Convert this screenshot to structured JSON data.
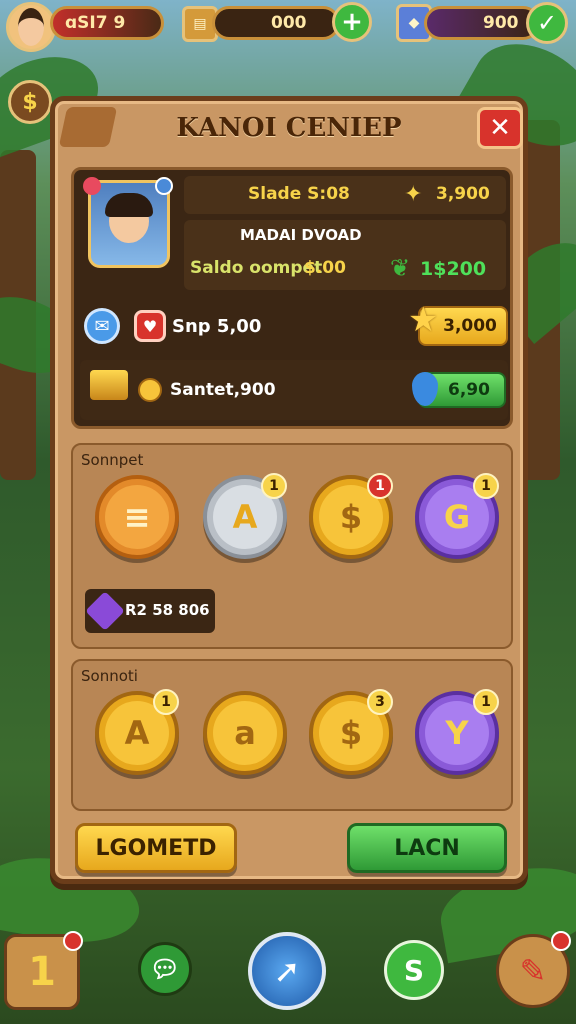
{
  "top_bar": {
    "lives_value": "ɑSI7 9",
    "energy_value": "000",
    "gems_value": "900",
    "plus_icon": "plus-icon",
    "check_icon": "check-icon"
  },
  "dialog": {
    "title": "KANOI CENIEP",
    "close_icon": "close-icon",
    "profile": {
      "slade_label": "Slade S:08",
      "slade_value": "3,900",
      "name_line": "MADAI DVOAD",
      "saldo_label": "Saldo oompet",
      "saldo_value": "$.00",
      "green_value": "1$200",
      "snp_label": "Snp 5,00",
      "star_value": "3,000",
      "santet_label": "Santet,900",
      "gem_value": "6,90"
    },
    "section1": {
      "title": "Sonnpet",
      "badges": [
        "1",
        "",
        "1",
        "1",
        "1"
      ],
      "coin_glyphs": [
        "≡",
        "A",
        "$",
        "G"
      ],
      "purple_tag": "R2 58 806"
    },
    "section2": {
      "title": "Sonnoti",
      "badges": [
        "1",
        "",
        "3",
        "1"
      ],
      "coin_glyphs": [
        "A",
        "a",
        "$",
        "Y"
      ]
    },
    "buttons": {
      "left": "LGOMETD",
      "right": "LACN"
    }
  },
  "bottom_bar": {
    "badge_1": "1",
    "dollar": "S"
  },
  "colors": {
    "panel": "#c99764",
    "gold": "#f7d34a",
    "green": "#3fb83f",
    "red": "#d8332c",
    "purple": "#8a5ad8"
  }
}
